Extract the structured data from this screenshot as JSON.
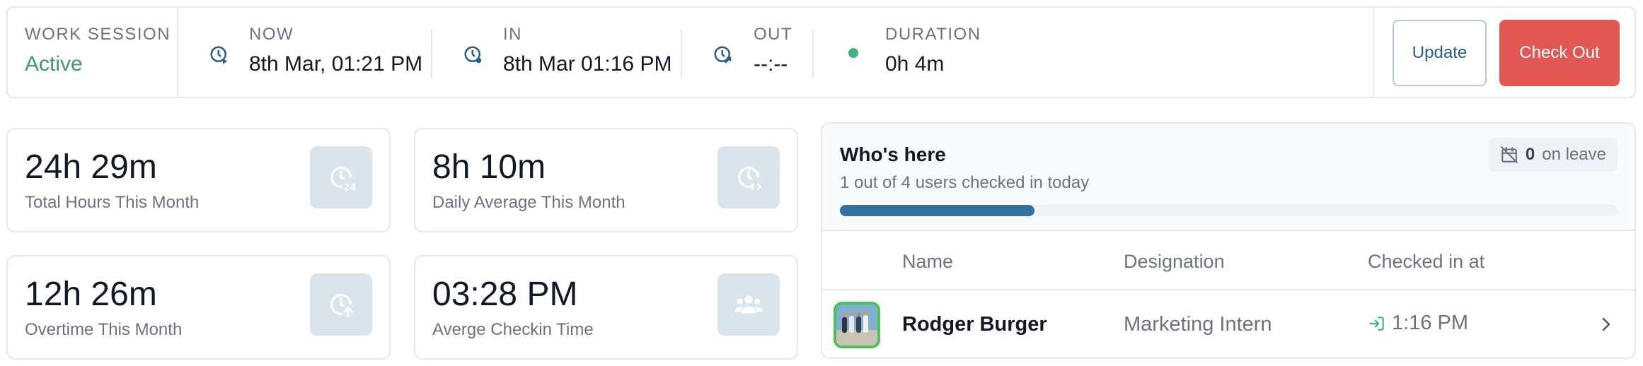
{
  "session": {
    "label": "WORK SESSION",
    "status": "Active",
    "now_label": "NOW",
    "now_value": "8th Mar, 01:21 PM",
    "in_label": "IN",
    "in_value": "8th Mar 01:16 PM",
    "out_label": "OUT",
    "out_value": "--:--",
    "duration_label": "DURATION",
    "duration_value": "0h 4m",
    "update_label": "Update",
    "checkout_label": "Check Out"
  },
  "stats": [
    {
      "value": "24h 29m",
      "label": "Total Hours This Month",
      "icon": "clock-24-icon"
    },
    {
      "value": "8h 10m",
      "label": "Daily Average This Month",
      "icon": "clock-code-icon"
    },
    {
      "value": "12h 26m",
      "label": "Overtime This Month",
      "icon": "clock-up-icon"
    },
    {
      "value": "03:28 PM",
      "label": "Averge Checkin Time",
      "icon": "users-icon"
    }
  ],
  "whos_here": {
    "title": "Who's here",
    "subtitle": "1 out of 4 users checked in today",
    "checked_in_fraction": 0.25,
    "leave_count": "0",
    "leave_text": "on leave",
    "columns": [
      "Name",
      "Designation",
      "Checked in at"
    ],
    "rows": [
      {
        "name": "Rodger Burger",
        "designation": "Marketing Intern",
        "checked_in": "1:16 PM"
      }
    ]
  },
  "colors": {
    "active": "#3f9b68",
    "checkout": "#e05753",
    "progress": "#33709f",
    "checkin_arrow": "#3fb27f"
  }
}
